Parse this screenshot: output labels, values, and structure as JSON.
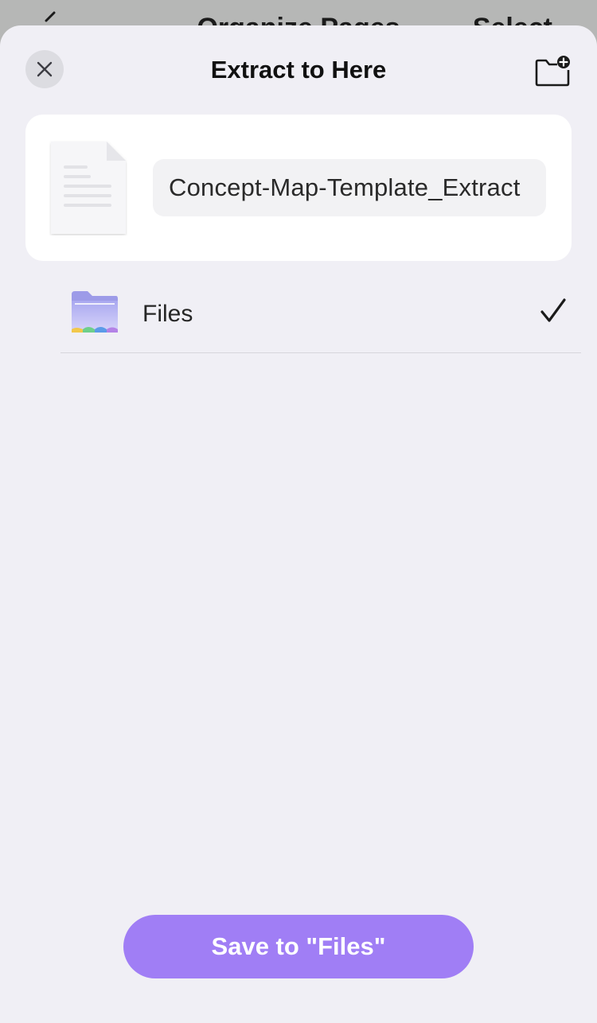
{
  "background": {
    "title": "Organize Pages",
    "select_label": "Select"
  },
  "sheet": {
    "title": "Extract to Here",
    "close_icon": "close-icon",
    "new_folder_icon": "folder-plus-icon"
  },
  "file": {
    "name_value": "Concept-Map-Template_Extract"
  },
  "destinations": [
    {
      "label": "Files",
      "selected": true
    }
  ],
  "save_button": {
    "label": "Save to \"Files\""
  },
  "colors": {
    "accent": "#a07ef5",
    "sheet_bg": "#f0eff5",
    "overlay": "#b6b7b6"
  }
}
